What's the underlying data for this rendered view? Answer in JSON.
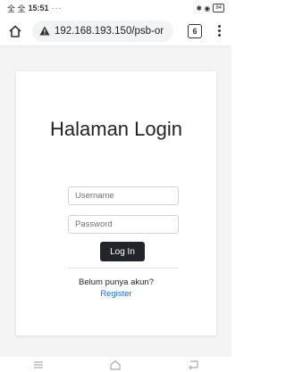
{
  "status_bar": {
    "sim_icons": "全 全",
    "time": "15:51",
    "extra": "···",
    "right_icons": "✱ ◉",
    "battery": "84"
  },
  "browser": {
    "url": "192.168.193.150/psb-or",
    "tab_count": "6",
    "icons": {
      "home": "home-icon",
      "warning": "warning-icon",
      "tabs": "tabs-counter-icon",
      "menu": "kebab-menu-icon"
    }
  },
  "login": {
    "title": "Halaman Login",
    "username_placeholder": "Username",
    "password_placeholder": "Password",
    "submit_label": "Log In",
    "register_prompt": "Belum punya akun?",
    "register_link": "Register"
  },
  "colors": {
    "button_bg": "#212529",
    "link": "#0d6efd",
    "page_bg": "#f4f4f4"
  },
  "nav_bar": {
    "icons": [
      "recents-icon",
      "home-icon",
      "back-icon"
    ]
  }
}
